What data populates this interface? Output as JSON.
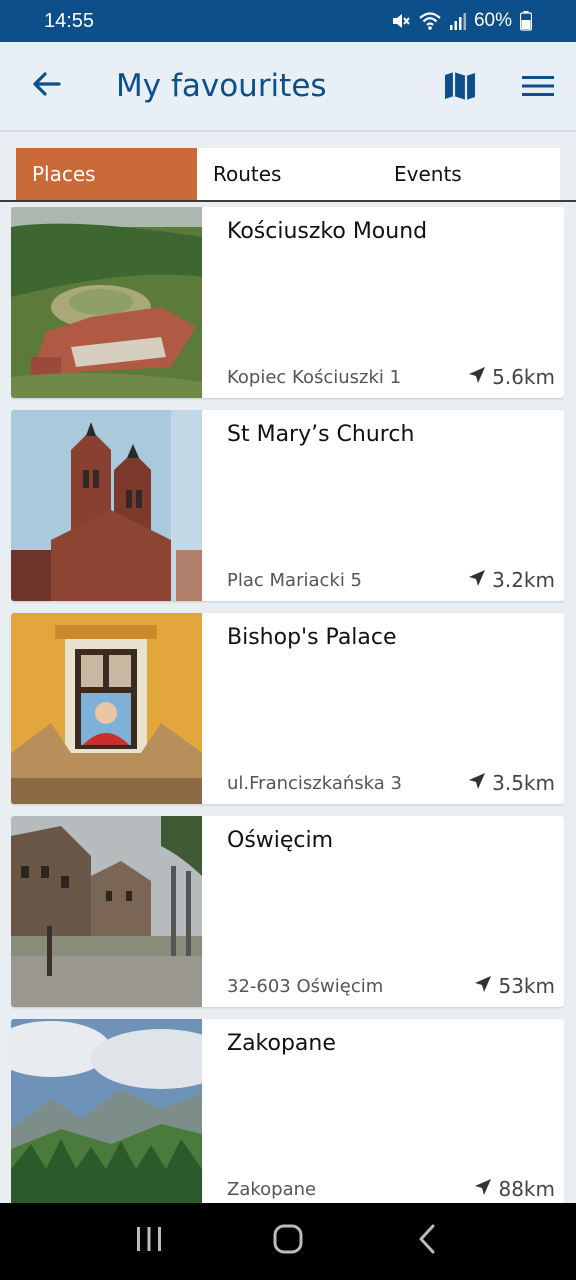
{
  "status_bar": {
    "time": "14:55",
    "battery": "60%"
  },
  "header": {
    "title": "My favourites",
    "icons": [
      "back-arrow-icon",
      "map-icon",
      "hamburger-menu-icon"
    ]
  },
  "tabs": [
    {
      "label": "Places",
      "active": true
    },
    {
      "label": "Routes",
      "active": false
    },
    {
      "label": "Events",
      "active": false
    }
  ],
  "places": [
    {
      "title": "Kościuszko Mound",
      "address": "Kopiec Kościuszki 1",
      "distance": "5.6km"
    },
    {
      "title": "St Mary’s Church",
      "address": "Plac Mariacki 5",
      "distance": "3.2km"
    },
    {
      "title": "Bishop's Palace",
      "address": "ul.Franciszkańska 3",
      "distance": "3.5km"
    },
    {
      "title": "Oświęcim",
      "address": "32-603 Oświęcim",
      "distance": "53km"
    },
    {
      "title": "Zakopane",
      "address": "Zakopane",
      "distance": "88km"
    }
  ],
  "colors": {
    "primary": "#0d4f8b",
    "accent_tab": "#c96a38",
    "app_bar_bg": "#e8eff6"
  }
}
